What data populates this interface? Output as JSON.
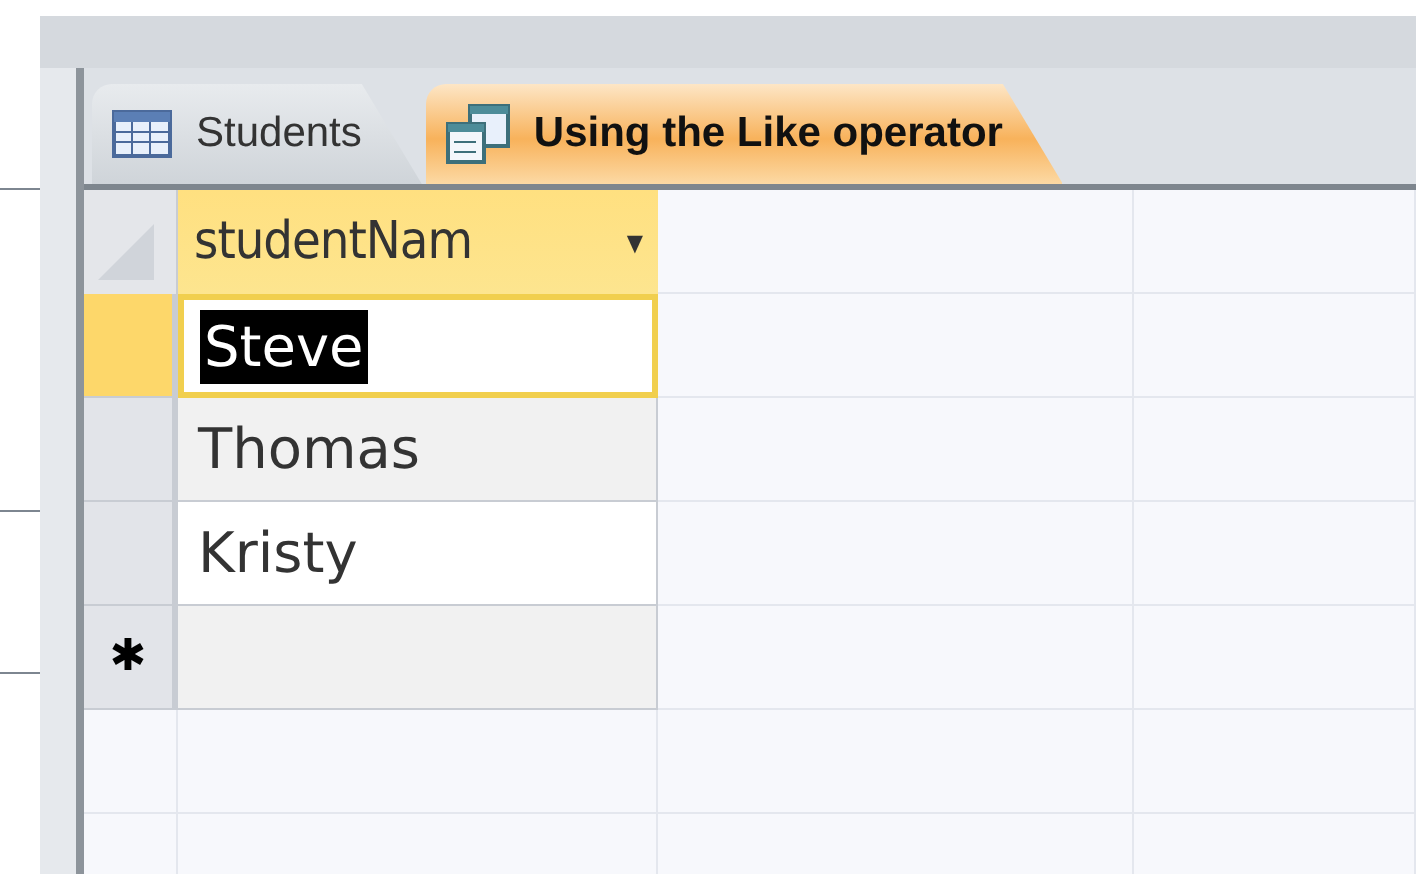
{
  "tabs": [
    {
      "label": "Students",
      "kind": "table",
      "selected": false
    },
    {
      "label": "Using the Like operator",
      "kind": "query",
      "selected": true
    }
  ],
  "datasheet": {
    "columns": [
      {
        "label": "studentNam",
        "dropdown": "▾"
      }
    ],
    "rows": [
      {
        "value": "Steve",
        "selected": true
      },
      {
        "value": "Thomas",
        "selected": false
      },
      {
        "value": "Kristy",
        "selected": false
      }
    ],
    "new_row_marker": "✱"
  }
}
